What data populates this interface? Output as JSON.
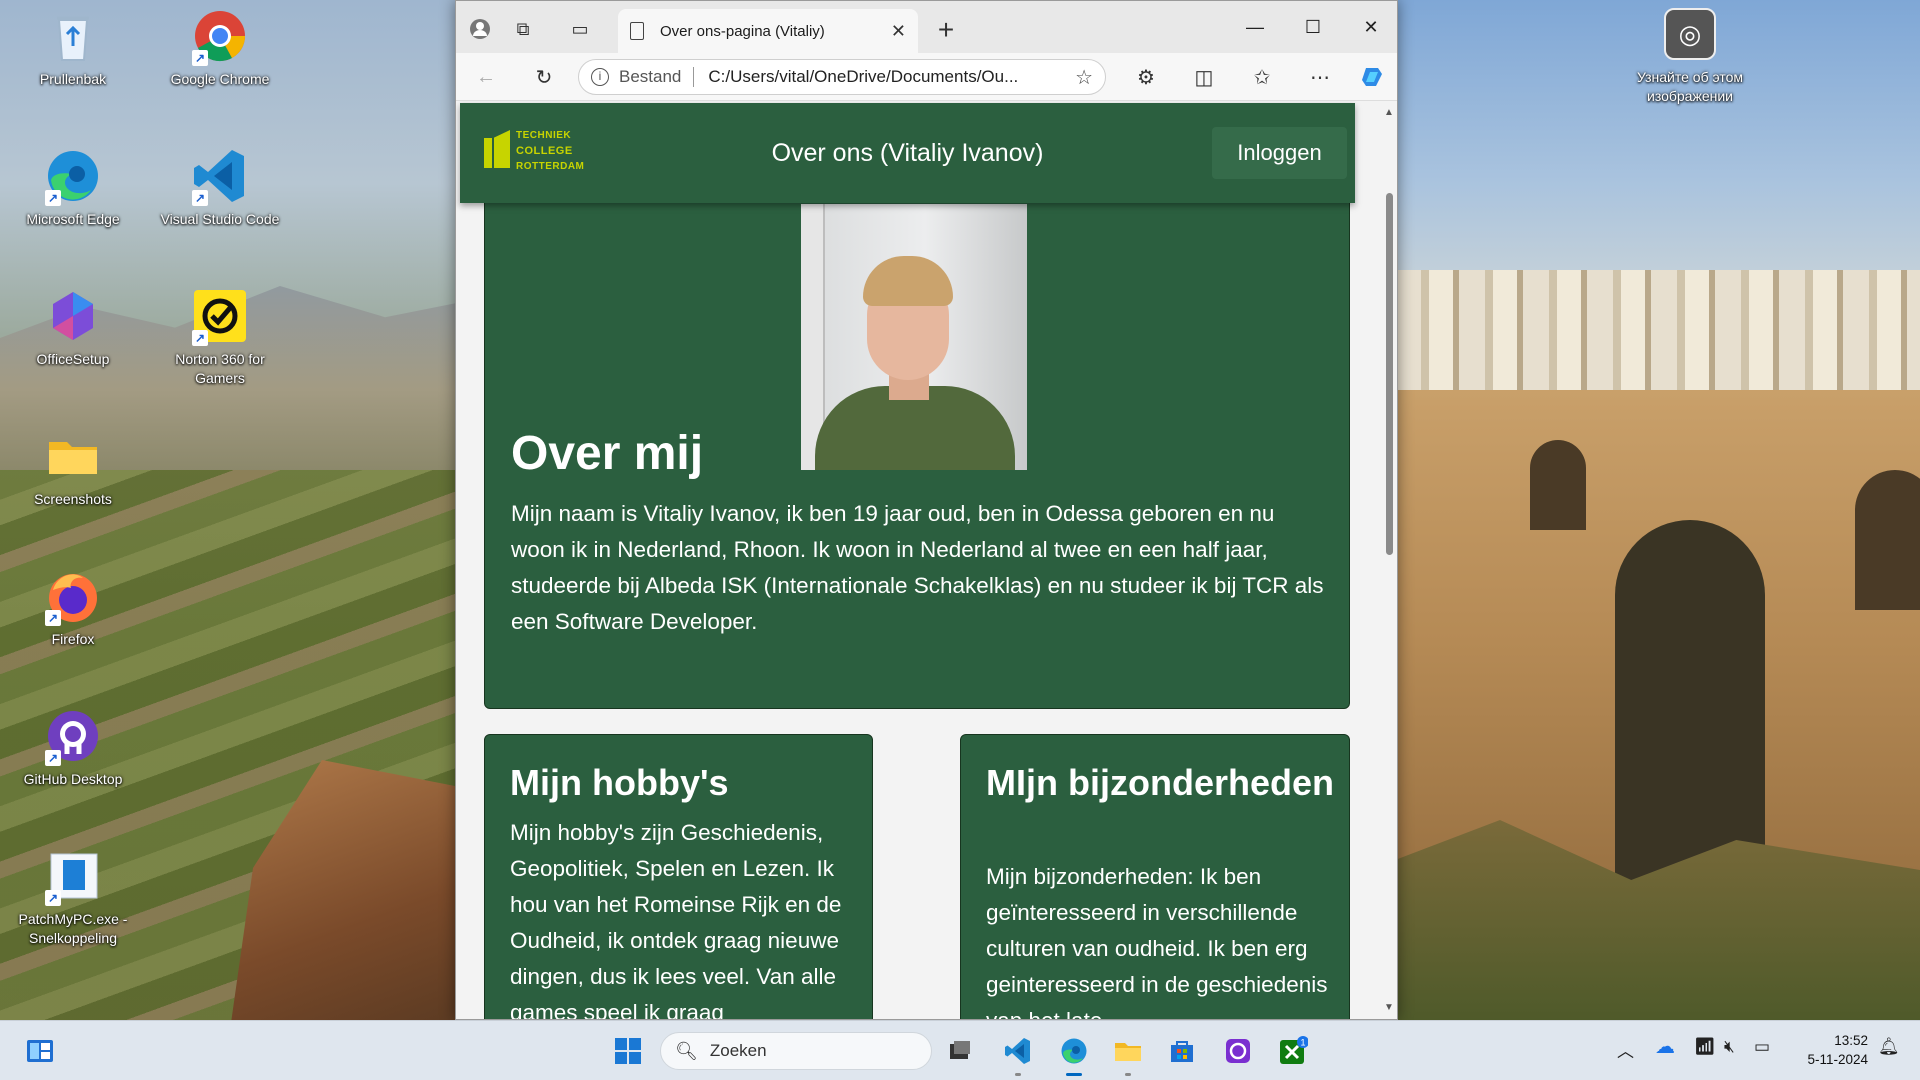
{
  "desktop": {
    "icons": [
      {
        "label": "Prullenbak"
      },
      {
        "label": "Google Chrome"
      },
      {
        "label": "Microsoft Edge"
      },
      {
        "label": "Visual Studio Code"
      },
      {
        "label": "OfficeSetup"
      },
      {
        "label": "Norton 360 for Gamers"
      },
      {
        "label": "Screenshots"
      },
      {
        "label": "Firefox"
      },
      {
        "label": "GitHub Desktop"
      },
      {
        "label": "PatchMyPC.exe - Snelkoppeling"
      }
    ],
    "lens_label": "Узнайте об этом изображении"
  },
  "browser": {
    "tab_title": "Over ons-pagina (Vitaliy)",
    "address_protocol": "Bestand",
    "address_url": "C:/Users/vital/OneDrive/Documents/Ou..."
  },
  "page": {
    "logo_lines": [
      "TECHNIEK",
      "COLLEGE",
      "ROTTERDAM"
    ],
    "header_title": "Over ons (Vitaliy Ivanov)",
    "login_label": "Inloggen",
    "about": {
      "heading": "Over mij",
      "text": "Mijn naam is Vitaliy Ivanov, ik ben 19 jaar oud, ben in Odessa geboren en nu woon ik in Nederland, Rhoon. Ik woon in Nederland al twee en een half jaar, studeerde bij Albeda ISK (Internationale Schakelklas) en nu studeer ik bij TCR als een Software Developer."
    },
    "hobbies": {
      "heading": "Mijn hobby's",
      "text": "Mijn hobby's zijn Geschiedenis, Geopolitiek, Spelen en Lezen. Ik hou van het Romeinse Rijk en de Oudheid, ik ontdek graag nieuwe dingen, dus ik lees veel. Van alle games speel ik graag"
    },
    "details": {
      "heading": "MIjn bijzonderheden",
      "text": "Mijn bijzonderheden: Ik ben geïnteresseerd in verschillende culturen van oudheid. Ik ben erg geinteresseerd in de geschiedenis van het late"
    }
  },
  "taskbar": {
    "search_placeholder": "Zoeken",
    "time": "13:52",
    "date": "5-11-2024",
    "badge_count": "1"
  },
  "colors": {
    "site_green": "#2b5f3f",
    "logo_yellow": "#c7d400",
    "accent_blue": "#0067c0"
  }
}
